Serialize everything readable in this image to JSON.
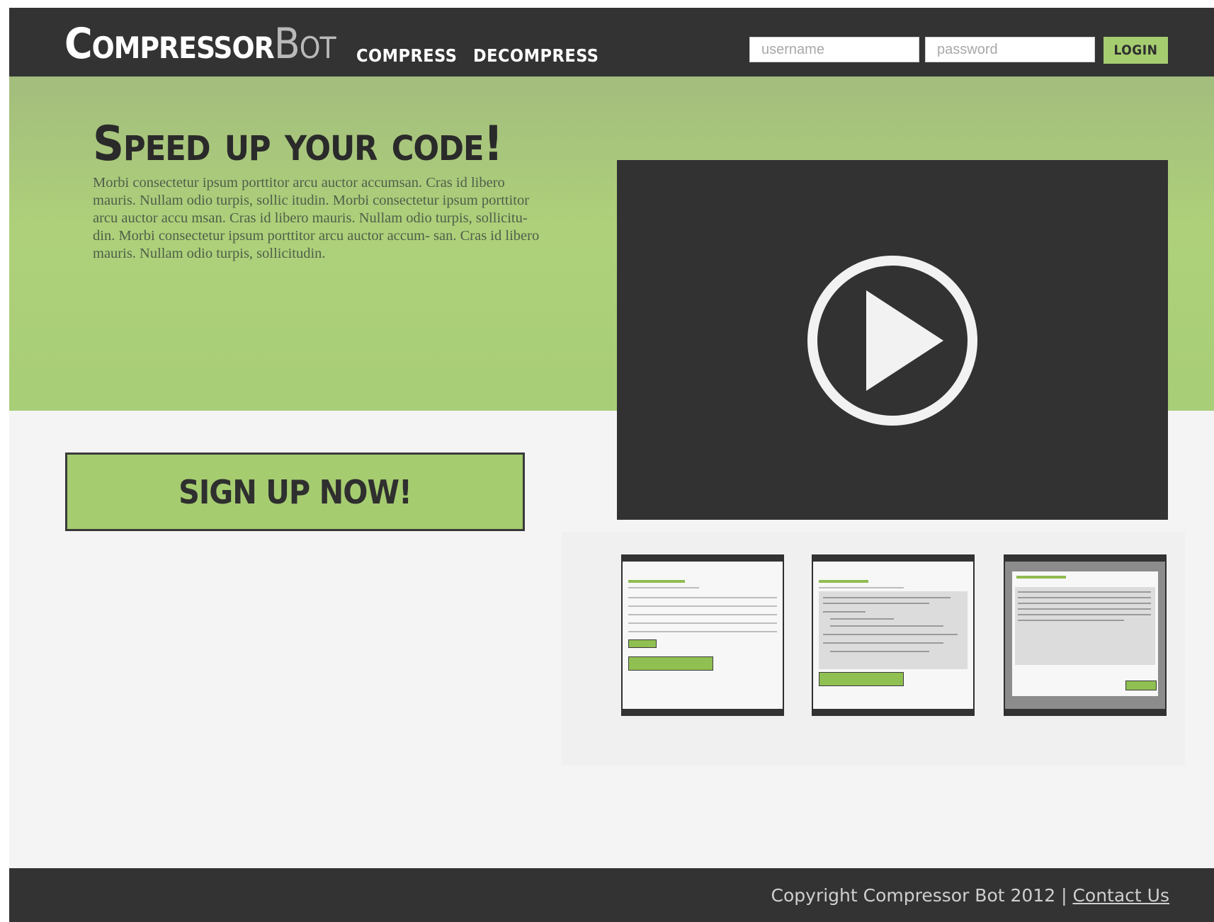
{
  "header": {
    "logo_main": "Compressor",
    "logo_accent": "Bot",
    "nav": {
      "compress": "COMPRESS",
      "decompress": "DECOMPRESS"
    },
    "login": {
      "username_placeholder": "username",
      "password_placeholder": "password",
      "button_label": "LOGIN"
    }
  },
  "hero": {
    "title": "Speed up your code!",
    "body": "Morbi consectetur ipsum porttitor arcu auctor accumsan. Cras id libero mauris. Nullam odio turpis, sollic itudin. Morbi consectetur ipsum porttitor arcu auctor accu msan. Cras id libero mauris. Nullam odio turpis, sollicitu- din. Morbi consectetur ipsum porttitor arcu auctor accum- san. Cras id libero mauris. Nullam odio turpis, sollicitudin."
  },
  "signup": {
    "label": "SIGN UP NOW!"
  },
  "video": {
    "icon": "play-icon"
  },
  "screenshots": [
    {
      "icon": "screenshot-file-list"
    },
    {
      "icon": "screenshot-code-input"
    },
    {
      "icon": "screenshot-compressed-output"
    }
  ],
  "footer": {
    "copyright": "Copyright Compressor Bot 2012",
    "separator": " | ",
    "contact_label": "Contact Us"
  },
  "colors": {
    "dark": "#333333",
    "accent_green": "#a6cc70",
    "background": "#f4f4f5"
  }
}
